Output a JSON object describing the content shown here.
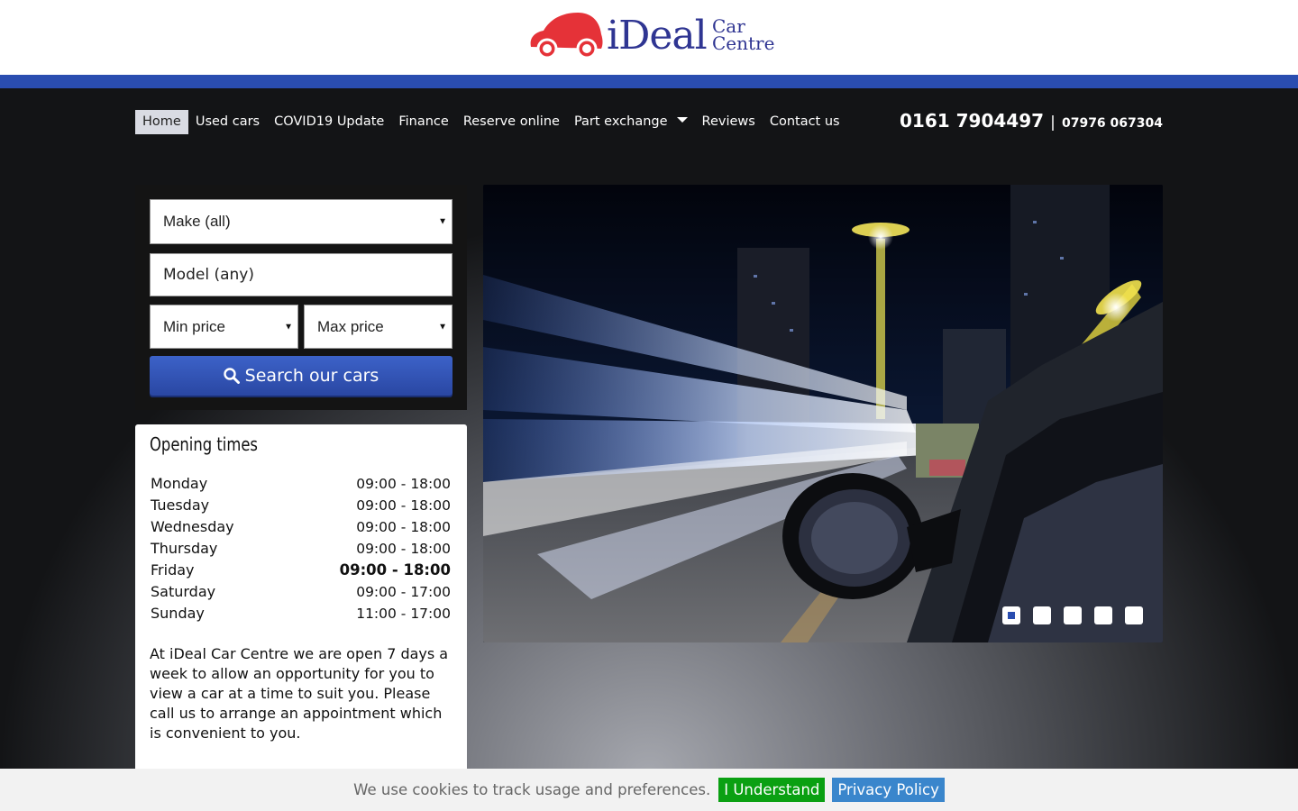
{
  "brand": {
    "name": "iDeal",
    "sub_line1": "Car",
    "sub_line2": "Centre"
  },
  "nav": {
    "items": [
      {
        "label": "Home",
        "active": true
      },
      {
        "label": "Used cars"
      },
      {
        "label": "COVID19 Update"
      },
      {
        "label": "Finance"
      },
      {
        "label": "Reserve online"
      },
      {
        "label": "Part exchange",
        "has_dropdown": true
      },
      {
        "label": "Reviews"
      },
      {
        "label": "Contact us"
      }
    ]
  },
  "contact": {
    "phone_main": "0161 7904497",
    "separator": "|",
    "phone_alt": "07976 067304"
  },
  "search": {
    "make_value": "Make (all)",
    "model_placeholder": "Model (any)",
    "min_price": "Min price",
    "max_price": "Max price",
    "button_label": "Search our cars"
  },
  "opening": {
    "title": "Opening times",
    "days": [
      {
        "day": "Monday",
        "hours": "09:00 - 18:00"
      },
      {
        "day": "Tuesday",
        "hours": "09:00 - 18:00"
      },
      {
        "day": "Wednesday",
        "hours": "09:00 - 18:00"
      },
      {
        "day": "Thursday",
        "hours": "09:00 - 18:00"
      },
      {
        "day": "Friday",
        "hours": "09:00 - 18:00",
        "today": true
      },
      {
        "day": "Saturday",
        "hours": "09:00 - 17:00"
      },
      {
        "day": "Sunday",
        "hours": "11:00 - 17:00"
      }
    ],
    "description": "At iDeal Car Centre we are open 7 days a week to allow an opportunity for you to view a car at a time to suit you. Please call us to arrange an appointment which is convenient to you."
  },
  "slider": {
    "slide_count": 5,
    "active_index": 0
  },
  "cookie": {
    "message": "We use cookies to track usage and preferences.",
    "accept_label": "I Understand",
    "policy_label": "Privacy Policy"
  },
  "colors": {
    "brand_blue": "#2a4db0",
    "logo_red": "#e53238",
    "accept_green": "#0aa012",
    "policy_blue": "#3a86cc"
  }
}
